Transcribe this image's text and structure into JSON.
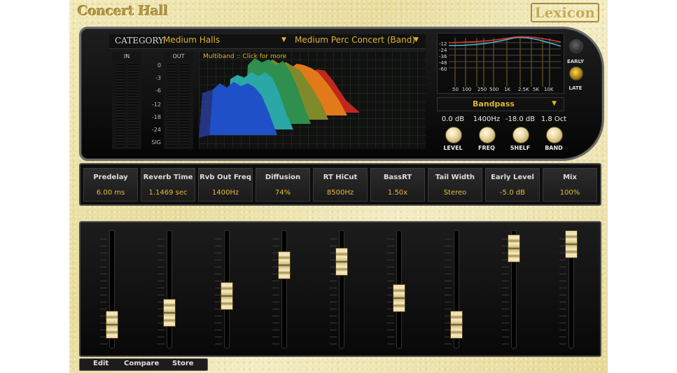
{
  "preset_title": "Concert Hall",
  "brand": "Lexicon",
  "category": {
    "label": "CATEGORY:",
    "category_value": "Medium Halls",
    "preset_value": "Medium Perc Concert (Band)"
  },
  "meters": {
    "in_label": "IN",
    "out_label": "OUT",
    "scale": [
      "0",
      "-3",
      "-6",
      "-12",
      "-18",
      "-24",
      "SIG"
    ]
  },
  "graph": {
    "note": "Multiband :: Click for more"
  },
  "eq": {
    "db_labels": [
      "-12",
      "-24",
      "-36",
      "-48",
      "-60"
    ],
    "freq_labels": [
      "50",
      "100",
      "250",
      "500",
      "1K",
      "2.5K",
      "5K",
      "10K"
    ],
    "filter_type": "Bandpass",
    "knobs": [
      {
        "label": "LEVEL",
        "value": "0.0 dB"
      },
      {
        "label": "FREQ",
        "value": "1400Hz"
      },
      {
        "label": "SHELF",
        "value": "-18.0 dB"
      },
      {
        "label": "BAND",
        "value": "1.8 Oct"
      }
    ]
  },
  "reflections": {
    "early_label": "EARLY",
    "late_label": "LATE"
  },
  "parameters": [
    {
      "name": "Predelay",
      "value": "6.00 ms",
      "level": 0.12
    },
    {
      "name": "Reverb Time",
      "value": "1.1469 sec",
      "level": 0.24
    },
    {
      "name": "Rvb Out Freq",
      "value": "1400Hz",
      "level": 0.42
    },
    {
      "name": "Diffusion",
      "value": "74%",
      "level": 0.74
    },
    {
      "name": "RT HiCut",
      "value": "8500Hz",
      "level": 0.78
    },
    {
      "name": "BassRT",
      "value": "1.50x",
      "level": 0.4
    },
    {
      "name": "Tail Width",
      "value": "Stereo",
      "level": 0.12
    },
    {
      "name": "Early Level",
      "value": "-5.0 dB",
      "level": 0.92
    },
    {
      "name": "Mix",
      "value": "100%",
      "level": 0.96
    }
  ],
  "buttons": {
    "edit": "Edit",
    "compare": "Compare",
    "store": "Store"
  },
  "colors": {
    "accent": "#e0b52b",
    "panel_bg": "#0d0d0d"
  }
}
